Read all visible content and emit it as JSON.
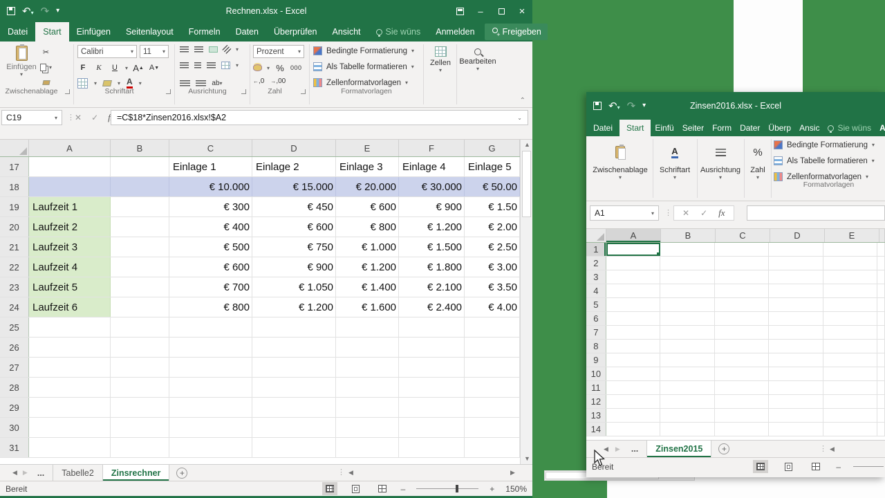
{
  "colors": {
    "excel_green": "#217346",
    "desktop_green": "#3e8e49",
    "row_highlight": "#ccd3ec",
    "label_highlight": "#d9ecca",
    "selection": "#217346"
  },
  "left_window": {
    "title": "Rechnen.xlsx - Excel",
    "tabs": [
      "Datei",
      "Start",
      "Einfügen",
      "Seitenlayout",
      "Formeln",
      "Daten",
      "Überprüfen",
      "Ansicht",
      "Sie wüns",
      "Anmelden",
      "Freigeben"
    ],
    "active_tab": "Start",
    "ribbon": {
      "paste_label": "Einfügen",
      "font_name": "Calibri",
      "font_size": "11",
      "bold": "F",
      "italic": "K",
      "underline": "U",
      "number_format": "Prozent",
      "percent": "%",
      "thousands": "000",
      "inc_dec": ",0",
      "dec_dec": ",00",
      "style_buttons": [
        "Bedingte Formatierung",
        "Als Tabelle formatieren",
        "Zellenformatvorlagen"
      ],
      "cells_label": "Zellen",
      "editing_label": "Bearbeiten",
      "group_labels": [
        "Zwischenablage",
        "Schriftart",
        "Ausrichtung",
        "Zahl",
        "Formatvorlagen"
      ]
    },
    "formula_bar": {
      "name_box": "C19",
      "fx": "fx",
      "formula": "=C$18*Zinsen2016.xlsx!$A2"
    },
    "grid": {
      "columns": [
        "A",
        "B",
        "C",
        "D",
        "E",
        "F",
        "G"
      ],
      "rows": [
        {
          "n": "17",
          "hl": "",
          "cells": [
            "",
            "",
            "Einlage 1",
            "Einlage 2",
            "Einlage 3",
            "Einlage 4",
            "Einlage 5"
          ]
        },
        {
          "n": "18",
          "hl": "row",
          "cells": [
            "",
            "",
            "€ 10.000",
            "€ 15.000",
            "€ 20.000",
            "€ 30.000",
            "€ 50.00"
          ]
        },
        {
          "n": "19",
          "hl": "a",
          "cells": [
            "Laufzeit 1",
            "",
            "€ 300",
            "€ 450",
            "€ 600",
            "€ 900",
            "€ 1.50"
          ]
        },
        {
          "n": "20",
          "hl": "a",
          "cells": [
            "Laufzeit 2",
            "",
            "€ 400",
            "€ 600",
            "€ 800",
            "€ 1.200",
            "€ 2.00"
          ]
        },
        {
          "n": "21",
          "hl": "a",
          "cells": [
            "Laufzeit 3",
            "",
            "€ 500",
            "€ 750",
            "€ 1.000",
            "€ 1.500",
            "€ 2.50"
          ]
        },
        {
          "n": "22",
          "hl": "a",
          "cells": [
            "Laufzeit 4",
            "",
            "€ 600",
            "€ 900",
            "€ 1.200",
            "€ 1.800",
            "€ 3.00"
          ]
        },
        {
          "n": "23",
          "hl": "a",
          "cells": [
            "Laufzeit 5",
            "",
            "€ 700",
            "€ 1.050",
            "€ 1.400",
            "€ 2.100",
            "€ 3.50"
          ]
        },
        {
          "n": "24",
          "hl": "a",
          "cells": [
            "Laufzeit 6",
            "",
            "€ 800",
            "€ 1.200",
            "€ 1.600",
            "€ 2.400",
            "€ 4.00"
          ]
        },
        {
          "n": "25",
          "hl": "",
          "cells": [
            "",
            "",
            "",
            "",
            "",
            "",
            ""
          ]
        },
        {
          "n": "26",
          "hl": "",
          "cells": [
            "",
            "",
            "",
            "",
            "",
            "",
            ""
          ]
        },
        {
          "n": "27",
          "hl": "",
          "cells": [
            "",
            "",
            "",
            "",
            "",
            "",
            ""
          ]
        },
        {
          "n": "28",
          "hl": "",
          "cells": [
            "",
            "",
            "",
            "",
            "",
            "",
            ""
          ]
        },
        {
          "n": "29",
          "hl": "",
          "cells": [
            "",
            "",
            "",
            "",
            "",
            "",
            ""
          ]
        },
        {
          "n": "30",
          "hl": "",
          "cells": [
            "",
            "",
            "",
            "",
            "",
            "",
            ""
          ]
        },
        {
          "n": "31",
          "hl": "",
          "cells": [
            "",
            "",
            "",
            "",
            "",
            "",
            ""
          ]
        }
      ]
    },
    "sheet_bar": {
      "ellipsis": "...",
      "tabs": [
        "Tabelle2",
        "Zinsrechner"
      ],
      "active": "Zinsrechner"
    },
    "status": {
      "ready": "Bereit",
      "zoom": "150%"
    }
  },
  "right_window": {
    "title": "Zinsen2016.xlsx - Excel",
    "tabs": [
      "Datei",
      "Start",
      "Einfü",
      "Seiter",
      "Form",
      "Dater",
      "Überp",
      "Ansic",
      "Sie wüns",
      "Anme"
    ],
    "active_tab": "Start",
    "ribbon": {
      "group_labels": [
        "Zwischenablage",
        "Schriftart",
        "Ausrichtung",
        "Zahl"
      ],
      "percent": "%",
      "style_buttons": [
        "Bedingte Formatierung",
        "Als Tabelle formatieren",
        "Zellenformatvorlagen"
      ],
      "styles_group_label": "Formatvorlagen"
    },
    "formula_bar": {
      "name_box": "A1",
      "fx": "fx",
      "formula": ""
    },
    "grid": {
      "columns": [
        "A",
        "B",
        "C",
        "D",
        "E"
      ],
      "row_count": 14,
      "selected_cell": "A1"
    },
    "sheet_bar": {
      "ellipsis": "...",
      "tabs": [
        "Zinsen2015"
      ],
      "active": "Zinsen2015"
    },
    "status": {
      "ready": "Bereit"
    }
  }
}
